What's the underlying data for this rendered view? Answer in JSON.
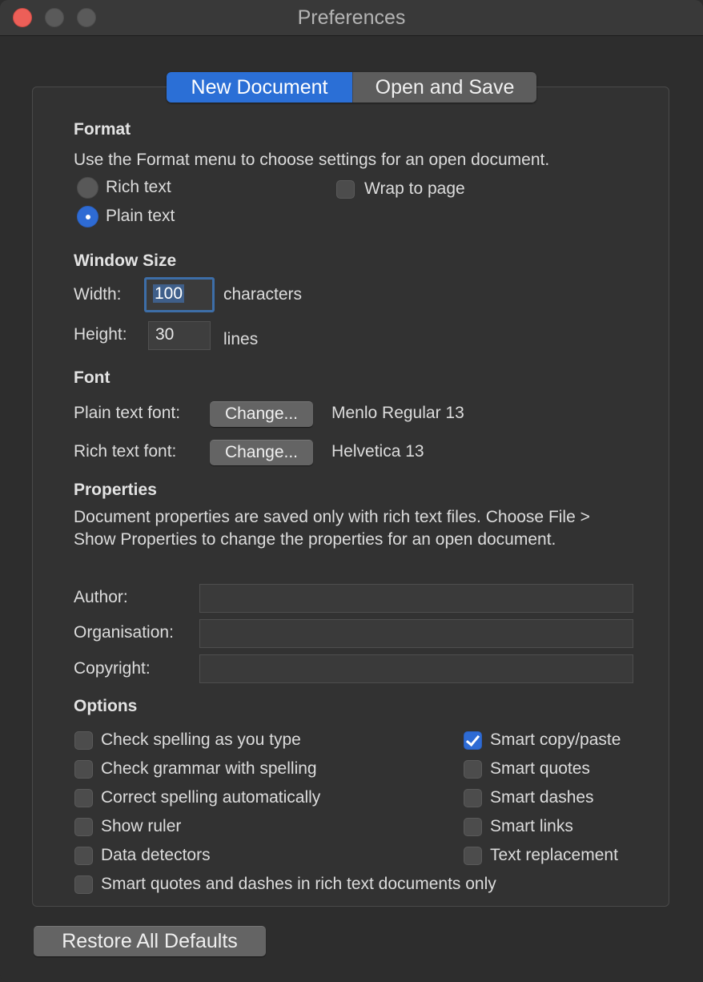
{
  "window": {
    "title": "Preferences"
  },
  "tabs": [
    {
      "label": "New Document",
      "active": true
    },
    {
      "label": "Open and Save",
      "active": false
    }
  ],
  "format": {
    "heading": "Format",
    "description": "Use the Format menu to choose settings for an open document.",
    "rich_text_label": "Rich text",
    "plain_text_label": "Plain text",
    "selected": "Plain text",
    "wrap_label": "Wrap to page",
    "wrap_checked": false
  },
  "window_size": {
    "heading": "Window Size",
    "width_label": "Width:",
    "width_value": "100",
    "width_unit": "characters",
    "height_label": "Height:",
    "height_value": "30",
    "height_unit": "lines"
  },
  "font": {
    "heading": "Font",
    "plain_label": "Plain text font:",
    "plain_button": "Change...",
    "plain_value": "Menlo Regular 13",
    "rich_label": "Rich text font:",
    "rich_button": "Change...",
    "rich_value": "Helvetica 13"
  },
  "properties": {
    "heading": "Properties",
    "description": "Document properties are saved only with rich text files. Choose File > Show Properties to change the properties for an open document.",
    "author_label": "Author:",
    "author_value": "",
    "organisation_label": "Organisation:",
    "organisation_value": "",
    "copyright_label": "Copyright:",
    "copyright_value": ""
  },
  "options": {
    "heading": "Options",
    "left": [
      {
        "label": "Check spelling as you type",
        "checked": false
      },
      {
        "label": "Check grammar with spelling",
        "checked": false
      },
      {
        "label": "Correct spelling automatically",
        "checked": false
      },
      {
        "label": "Show ruler",
        "checked": false
      },
      {
        "label": "Data detectors",
        "checked": false
      },
      {
        "label": "Smart quotes and dashes in rich text documents only",
        "checked": false
      }
    ],
    "right": [
      {
        "label": "Smart copy/paste",
        "checked": true
      },
      {
        "label": "Smart quotes",
        "checked": false
      },
      {
        "label": "Smart dashes",
        "checked": false
      },
      {
        "label": "Smart links",
        "checked": false
      },
      {
        "label": "Text replacement",
        "checked": false
      }
    ]
  },
  "footer": {
    "restore_button": "Restore All Defaults"
  },
  "colors": {
    "accent": "#2b6fd6",
    "close_button": "#ec5f58",
    "background": "#2d2d2d"
  }
}
